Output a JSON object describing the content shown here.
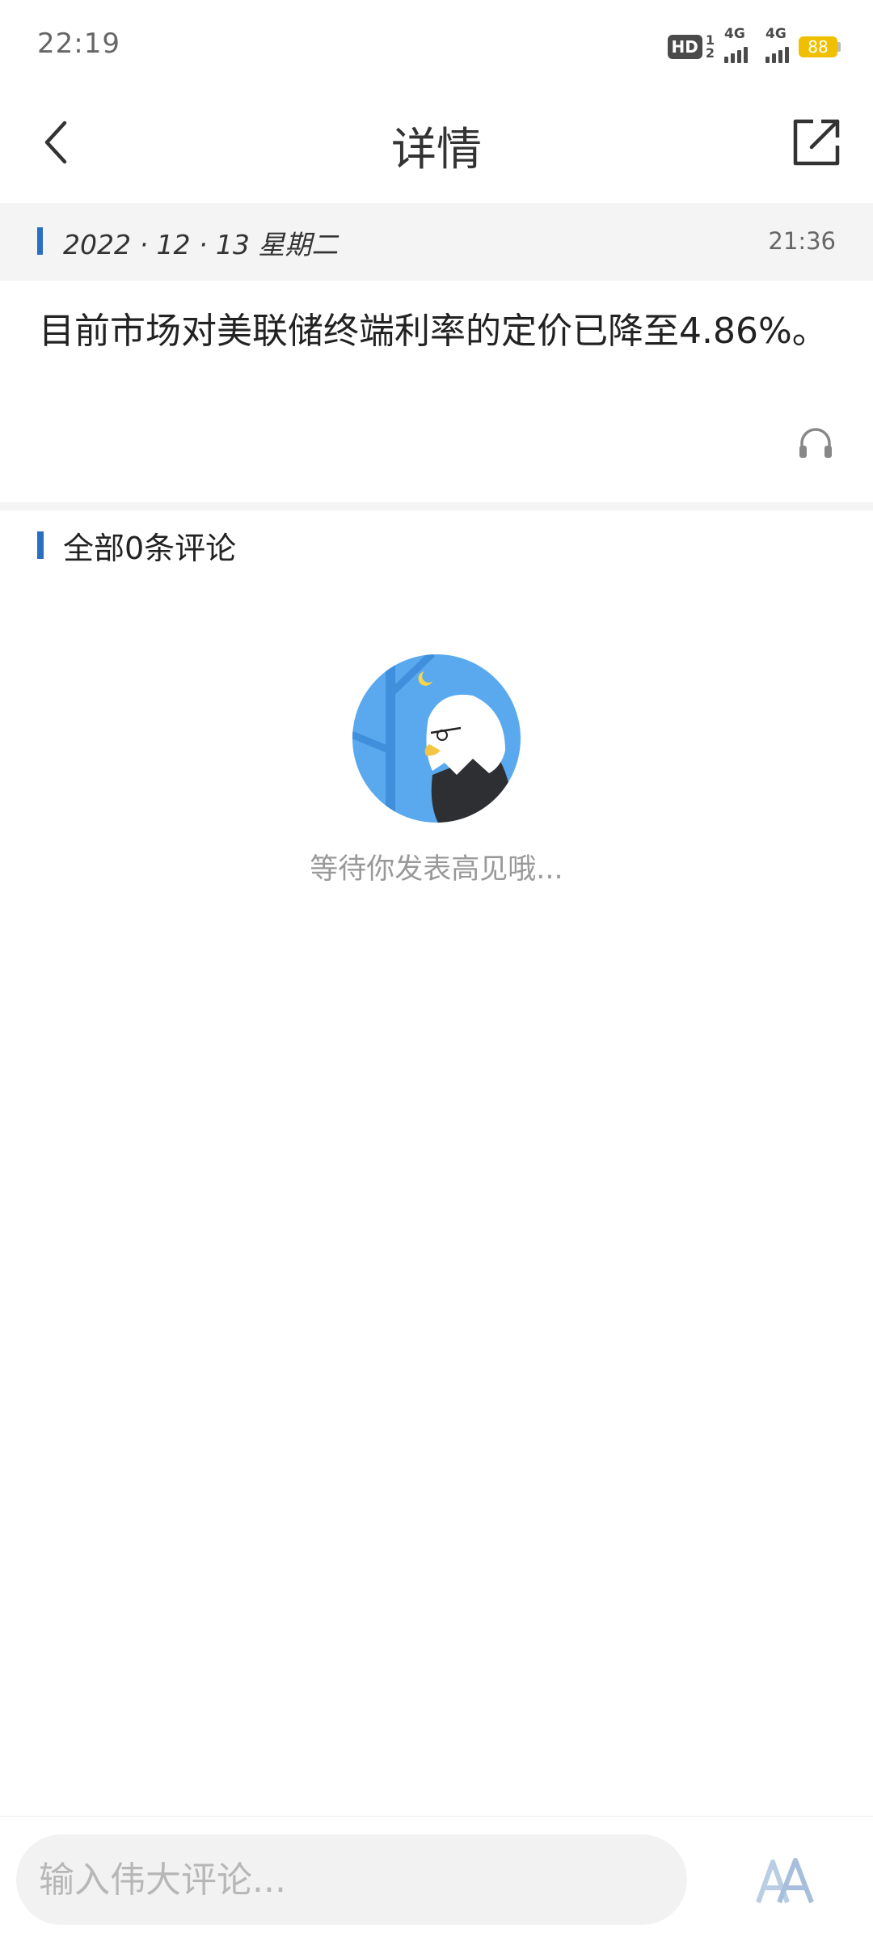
{
  "status_bar": {
    "time": "22:19",
    "hd_label": "HD",
    "sim_labels": [
      "1",
      "2"
    ],
    "net1": "4G",
    "net2": "4G",
    "battery": "88"
  },
  "nav": {
    "back_icon": "chevron-left-icon",
    "title": "详情",
    "share_icon": "share-external-icon"
  },
  "article": {
    "date": "2022 · 12 · 13  星期二",
    "time": "21:36",
    "content": "目前市场对美联储终端利率的定价已降至4.86%。",
    "audio_icon": "headphones-icon"
  },
  "comments": {
    "header": "全部0条评论",
    "empty_text": "等待你发表高见哦..."
  },
  "bottom": {
    "input_placeholder": "输入伟大评论...",
    "font_icon": "font-size-icon"
  },
  "colors": {
    "accent": "#2b6fc2",
    "strip_bg": "#f4f4f4",
    "battery": "#f0c000",
    "illus_bg": "#5aa9ee"
  }
}
